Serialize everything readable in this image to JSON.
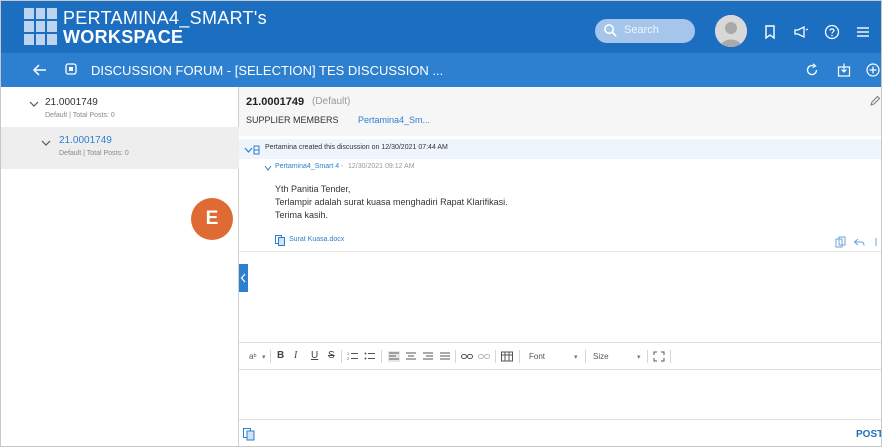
{
  "header": {
    "brand_line1": "PERTAMINA4_SMART's",
    "brand_line2": "WORKSPACE",
    "search_placeholder": "Search",
    "icons": [
      "bookmark-icon",
      "announcement-icon",
      "help-icon",
      "menu-icon"
    ]
  },
  "subbar": {
    "title": "DISCUSSION FORUM - [SELECTION] TES DISCUSSION ...",
    "icons": [
      "back-arrow-icon",
      "forum-icon",
      "refresh-icon",
      "export-icon",
      "add-icon"
    ]
  },
  "sidebar": {
    "items": [
      {
        "id": "21.0001749",
        "sub": "Default | Total Posts: 0"
      },
      {
        "id": "21.0001749",
        "sub": "Default | Total Posts: 0"
      }
    ]
  },
  "badge": {
    "label": "E",
    "color": "#e06a34"
  },
  "detail": {
    "id": "21.0001749",
    "tag": "(Default)",
    "members_label": "SUPPLIER MEMBERS",
    "members_value": "Pertamina4_Sm...",
    "thread_created": "Pertamina created this discussion on 12/30/2021 07:44 AM",
    "post": {
      "author": "Pertamina4_Smart 4",
      "separator": "-",
      "time": "12/30/2021 09:12 AM",
      "lines": [
        "Yth Panitia Tender,",
        "Terlampir adalah surat kuasa menghadiri Rapat Klarifikasi.",
        "Terima kasih."
      ],
      "attachment": "Surat Kuasa.docx"
    }
  },
  "editor": {
    "font_label": "Font",
    "size_label": "Size",
    "post_label": "POST"
  },
  "colors": {
    "primary": "#1c6fc0",
    "secondary": "#2d7fd0",
    "link": "#2d7fd0"
  }
}
